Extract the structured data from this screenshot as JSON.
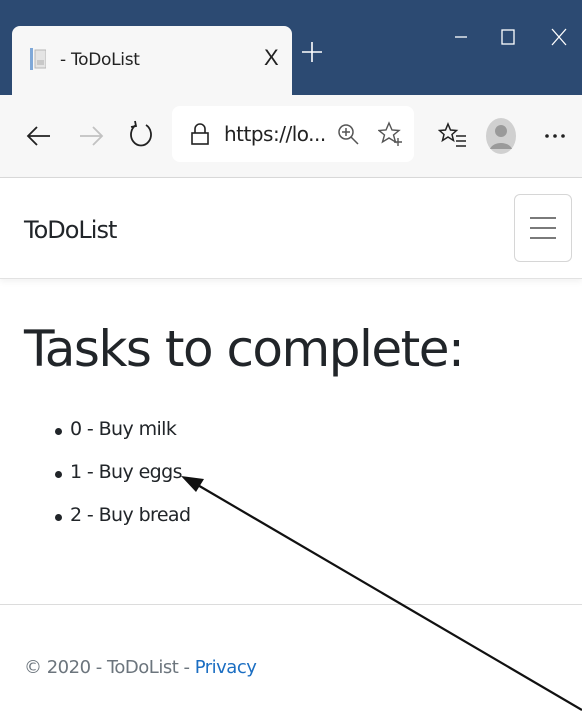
{
  "browser": {
    "tab_title": "- ToDoList",
    "tab_close": "X",
    "url": "https://lo...",
    "accent": "#2c4a72"
  },
  "icons": {
    "back": "arrow-left-icon",
    "forward": "arrow-right-icon",
    "refresh": "refresh-icon",
    "lock": "lock-icon",
    "zoom": "zoom-icon",
    "favorite": "star-add-icon",
    "favorites_list": "favorites-list-icon",
    "profile": "profile-icon",
    "more": "more-icon",
    "menu": "hamburger-icon"
  },
  "page": {
    "brand": "ToDoList",
    "heading": "Tasks to complete:",
    "tasks": [
      "0 - Buy milk",
      "1 - Buy eggs",
      "2 - Buy bread"
    ],
    "footer_text": "© 2020 - ToDoList - ",
    "footer_link": "Privacy",
    "link_color": "#1b6ec2"
  }
}
